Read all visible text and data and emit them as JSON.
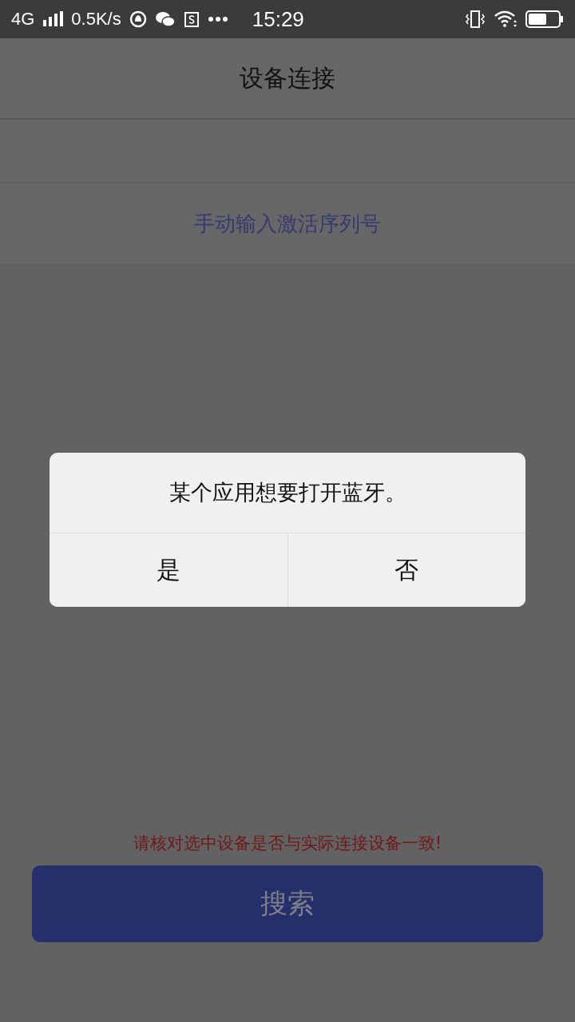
{
  "status_bar": {
    "network": "4G",
    "speed": "0.5K/s",
    "time": "15:29"
  },
  "header": {
    "title": "设备连接"
  },
  "rows": [
    {
      "kind": "empty"
    },
    {
      "kind": "link",
      "label": "手动输入激活序列号"
    }
  ],
  "hint": "请核对选中设备是否与实际连接设备一致!",
  "search_button": "搜索",
  "dialog": {
    "message": "某个应用想要打开蓝牙。",
    "buttons": [
      "是",
      "否"
    ]
  }
}
